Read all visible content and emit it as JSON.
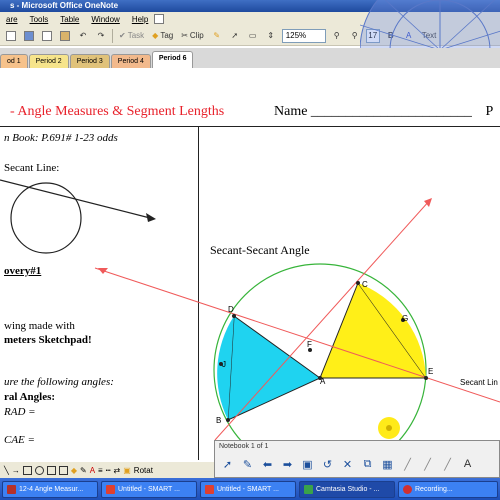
{
  "window": {
    "title": "s - Microsoft Office OneNote"
  },
  "menu": [
    "are",
    "Tools",
    "Table",
    "Window",
    "Help"
  ],
  "toolbar": {
    "tag_label": "Tag",
    "clip_label": "Clip",
    "zoom": "125%",
    "font_size": "17",
    "text_label": "Text"
  },
  "tabs": [
    {
      "label": "od 1",
      "color": "#f6c28b"
    },
    {
      "label": "Period 2",
      "color": "#f6e48b"
    },
    {
      "label": "Period 3",
      "color": "#e0c27a"
    },
    {
      "label": "Period 4",
      "color": "#f2b98c"
    },
    {
      "label": "Period 6",
      "color": "#ffffff"
    }
  ],
  "page": {
    "title": "- Angle Measures & Segment Lengths",
    "name_label": "Name _______________________",
    "period_label": "P",
    "book_line": "n Book:  P.691#  1-23 odds",
    "secant_line_heading": "Secant Line:",
    "discovery": "overy#1",
    "drawing_line1": "wing made with",
    "drawing_line2": "meters Sketchpad!",
    "measure_line": "ure the following angles:",
    "central_angles": "ral Angles:",
    "rad_line": "RAD =",
    "cae_line": "CAE =",
    "secant_secant": "Secant-Secant Angle",
    "secant_line_label": "Secant Lin",
    "points": {
      "C": "C",
      "D": "D",
      "F": "F",
      "J": "J",
      "A": "A",
      "E": "E",
      "B": "B",
      "G": "G"
    }
  },
  "notebook": {
    "title": "Notebook  1 of 1",
    "tools": [
      "pointer-icon",
      "pen-icon",
      "back-arrow-icon",
      "forward-arrow-icon",
      "page-icon",
      "undo-icon",
      "delete-icon",
      "screen-icon",
      "table-icon",
      "highlighter-icon",
      "marker-icon",
      "eraser-icon",
      "text-icon"
    ]
  },
  "drawbar": {
    "rotate_label": "Rotat"
  },
  "taskbar": [
    {
      "label": "12-4 Angle Measur...",
      "color": "#b5312a"
    },
    {
      "label": "Untitled - SMART ...",
      "color": "#e04030"
    },
    {
      "label": "Untitled - SMART ...",
      "color": "#e04030"
    },
    {
      "label": "Camtasia Studio - ...",
      "color": "#3aa34a"
    },
    {
      "label": "Recording...",
      "color": "#d03030"
    }
  ],
  "colors": {
    "accent_red": "#e8212b",
    "triangle_cyan": "#1fd3f0",
    "triangle_yellow": "#ffef18",
    "circle_green": "#37b43a",
    "secant_red": "#f05a5a"
  }
}
